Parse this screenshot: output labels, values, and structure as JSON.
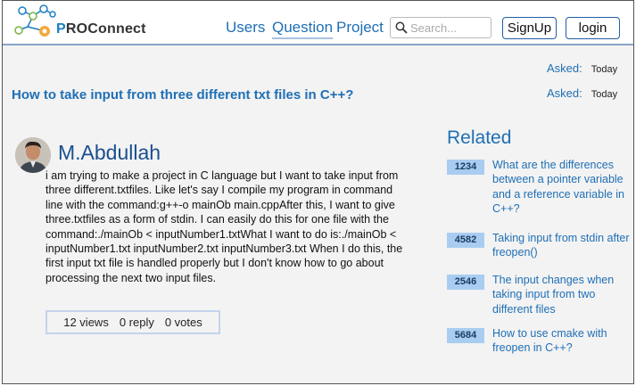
{
  "brand": {
    "name_prefix": "P",
    "name_rest": "ROConnect"
  },
  "nav": {
    "users": "Users",
    "question": "Question",
    "project": "Project"
  },
  "search": {
    "placeholder": "Search..."
  },
  "auth": {
    "signup": "SignUp",
    "login": "login"
  },
  "question": {
    "asked_label_1": "Asked:",
    "asked_value_1": "Today",
    "asked_label_2": "Asked:",
    "asked_value_2": "Today",
    "title": "How to take input from three different txt files in C++?",
    "author": "M.Abdullah",
    "body": "i am trying to make a project in C language but I want to take input from three different.txtfiles. Like let's say I compile my program in command line with the command:g++-o mainOb main.cppAfter this, I want to give three.txtfiles as a form of stdin. I can easily do this for one file with the command:./mainOb < inputNumber1.txtWhat I want to do is:./mainOb < inputNumber1.txt inputNumber2.txt inputNumber3.txt When I do this, the first input txt file is handled properly but I don't know how to go about processing the next two input files.",
    "stats": {
      "views": "12 views",
      "replies": "0 reply",
      "votes": "0 votes"
    }
  },
  "related": {
    "title": "Related",
    "items": [
      {
        "count": "1234",
        "text": "What are the differences between a pointer variable and a reference variable in C++?"
      },
      {
        "count": "4582",
        "text": "Taking input from stdin after freopen()"
      },
      {
        "count": "2546",
        "text": "The input changes when taking input from two different files"
      },
      {
        "count": "5684",
        "text": "How to use cmake with freopen in C++?"
      }
    ]
  },
  "colors": {
    "accent": "#1f6fb5",
    "badge": "#a8cdf0",
    "header_border": "#8aa4c8"
  }
}
